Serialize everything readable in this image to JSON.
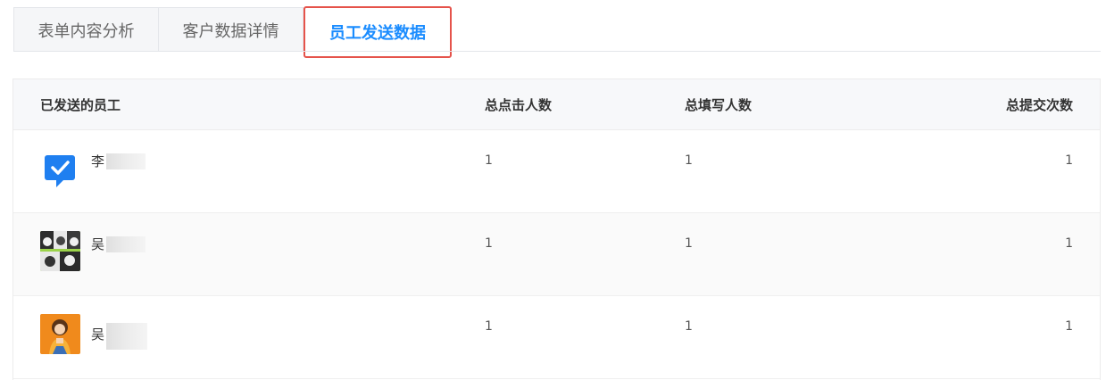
{
  "tabs": [
    {
      "label": "表单内容分析",
      "active": false
    },
    {
      "label": "客户数据详情",
      "active": false
    },
    {
      "label": "员工发送数据",
      "active": true
    }
  ],
  "table": {
    "headers": [
      "已发送的员工",
      "总点击人数",
      "总填写人数",
      "总提交次数"
    ],
    "rows": [
      {
        "name": "李",
        "avatar": "wecom-check-icon",
        "clicks": "1",
        "fills": "1",
        "submits": "1"
      },
      {
        "name": "吴",
        "avatar": "manga-avatar",
        "clicks": "1",
        "fills": "1",
        "submits": "1"
      },
      {
        "name": "吴",
        "avatar": "girl-orange-avatar",
        "clicks": "1",
        "fills": "1",
        "submits": "1"
      }
    ]
  },
  "colors": {
    "accent": "#1a8cff",
    "highlight_border": "#e5534b"
  }
}
